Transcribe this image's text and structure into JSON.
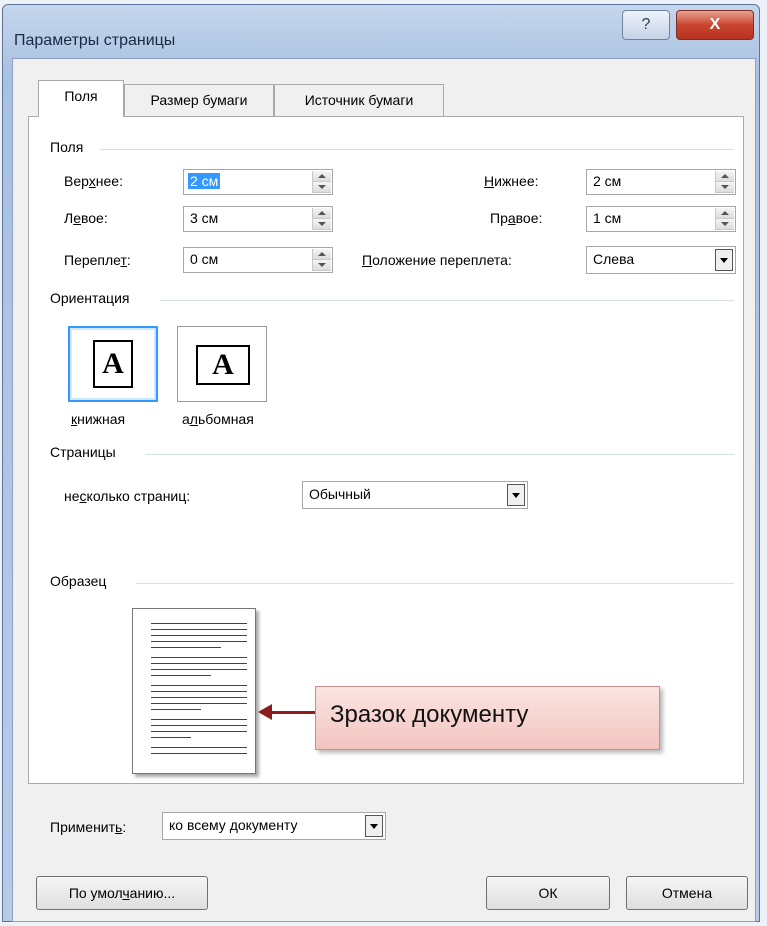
{
  "window": {
    "title": "Параметры страницы",
    "help_label": "?",
    "close_label": "X"
  },
  "tabs": [
    {
      "label": "Поля",
      "active": true
    },
    {
      "label": "Размер бумаги",
      "active": false
    },
    {
      "label": "Источник бумаги",
      "active": false
    }
  ],
  "margins": {
    "group_label": "Поля",
    "top": {
      "label": "Верхнее:",
      "value": "2 см"
    },
    "bottom": {
      "label": "Нижнее:",
      "value": "2 см"
    },
    "left": {
      "label": "Левое:",
      "value": "3 см"
    },
    "right": {
      "label": "Правое:",
      "value": "1 см"
    },
    "gutter": {
      "label": "Переплет:",
      "value": "0 см"
    },
    "gutter_position": {
      "label": "Положение переплета:",
      "value": "Слева"
    }
  },
  "orientation": {
    "group_label": "Ориентация",
    "portrait_label": "книжная",
    "landscape_label": "альбомная",
    "icon_letter": "A",
    "selected": "portrait"
  },
  "pages": {
    "group_label": "Страницы",
    "multiple_label": "несколько страниц:",
    "multiple_value": "Обычный"
  },
  "preview": {
    "group_label": "Образец",
    "callout": "Зразок документу"
  },
  "apply": {
    "label": "Применить:",
    "value": "ко всему документу"
  },
  "buttons": {
    "default": "По умолчанию...",
    "ok": "ОК",
    "cancel": "Отмена"
  },
  "colors": {
    "selection": "#3399ff",
    "callout_arrow": "#8b1d1d",
    "close_button": "#c9452f"
  }
}
